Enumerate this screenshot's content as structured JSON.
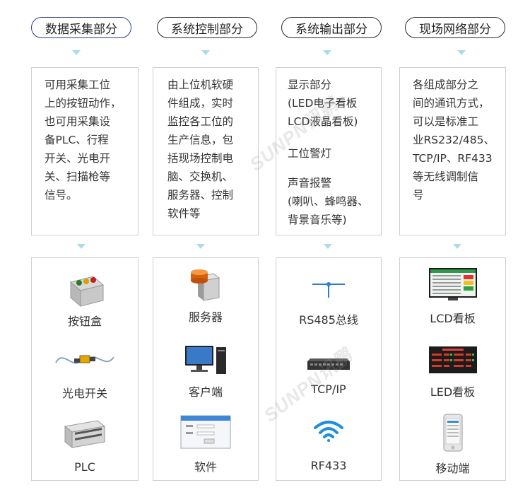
{
  "columns": [
    {
      "title": "数据采集部分",
      "desc": "可用采集工位\n上的按钮动作，\n也可用采集设\n备PLC、行程\n开关、光电开\n关、扫描枪等\n信号。",
      "items": [
        {
          "label": "按钮盒",
          "icon": "button-box-icon"
        },
        {
          "label": "光电开关",
          "icon": "photoelectric-switch-icon"
        },
        {
          "label": "PLC",
          "icon": "plc-icon"
        }
      ]
    },
    {
      "title": "系统控制部分",
      "desc": "由上位机软硬\n件组成，实时\n监控各工位的\n生产信息，包\n括现场控制电\n脑、交换机、\n服务器、控制\n软件等",
      "items": [
        {
          "label": "服务器",
          "icon": "server-icon"
        },
        {
          "label": "客户端",
          "icon": "desktop-computer-icon"
        },
        {
          "label": "软件",
          "icon": "software-window-icon"
        }
      ]
    },
    {
      "title": "系统输出部分",
      "desc_blocks": [
        "显示部分\n(LED电子看板\n LCD液晶看板)",
        "工位警灯",
        "声音报警\n(喇叭、蜂鸣器、\n背景音乐等)"
      ],
      "items": [
        {
          "label": "RS485总线",
          "icon": "bus-line-icon"
        },
        {
          "label": "TCP/IP",
          "icon": "network-switch-icon"
        },
        {
          "label": "RF433",
          "icon": "wifi-icon"
        }
      ]
    },
    {
      "title": "现场网络部分",
      "desc": "各组成部分之\n间的通讯方式，\n可以是标准工\n业RS232/485、\nTCP/IP、RF433\n等无线调制信\n号",
      "items": [
        {
          "label": "LCD看板",
          "icon": "lcd-board-icon"
        },
        {
          "label": "LED看板",
          "icon": "led-board-icon"
        },
        {
          "label": "移动端",
          "icon": "mobile-phone-icon"
        }
      ]
    }
  ],
  "watermark": "SUNPN讯鹏",
  "colors": {
    "arrow": "#a9dcea",
    "border": "#cfcfcf",
    "pill_border": "#2a2a2a",
    "wifi": "#1d8fe0",
    "bus": "#2c7fc8"
  }
}
